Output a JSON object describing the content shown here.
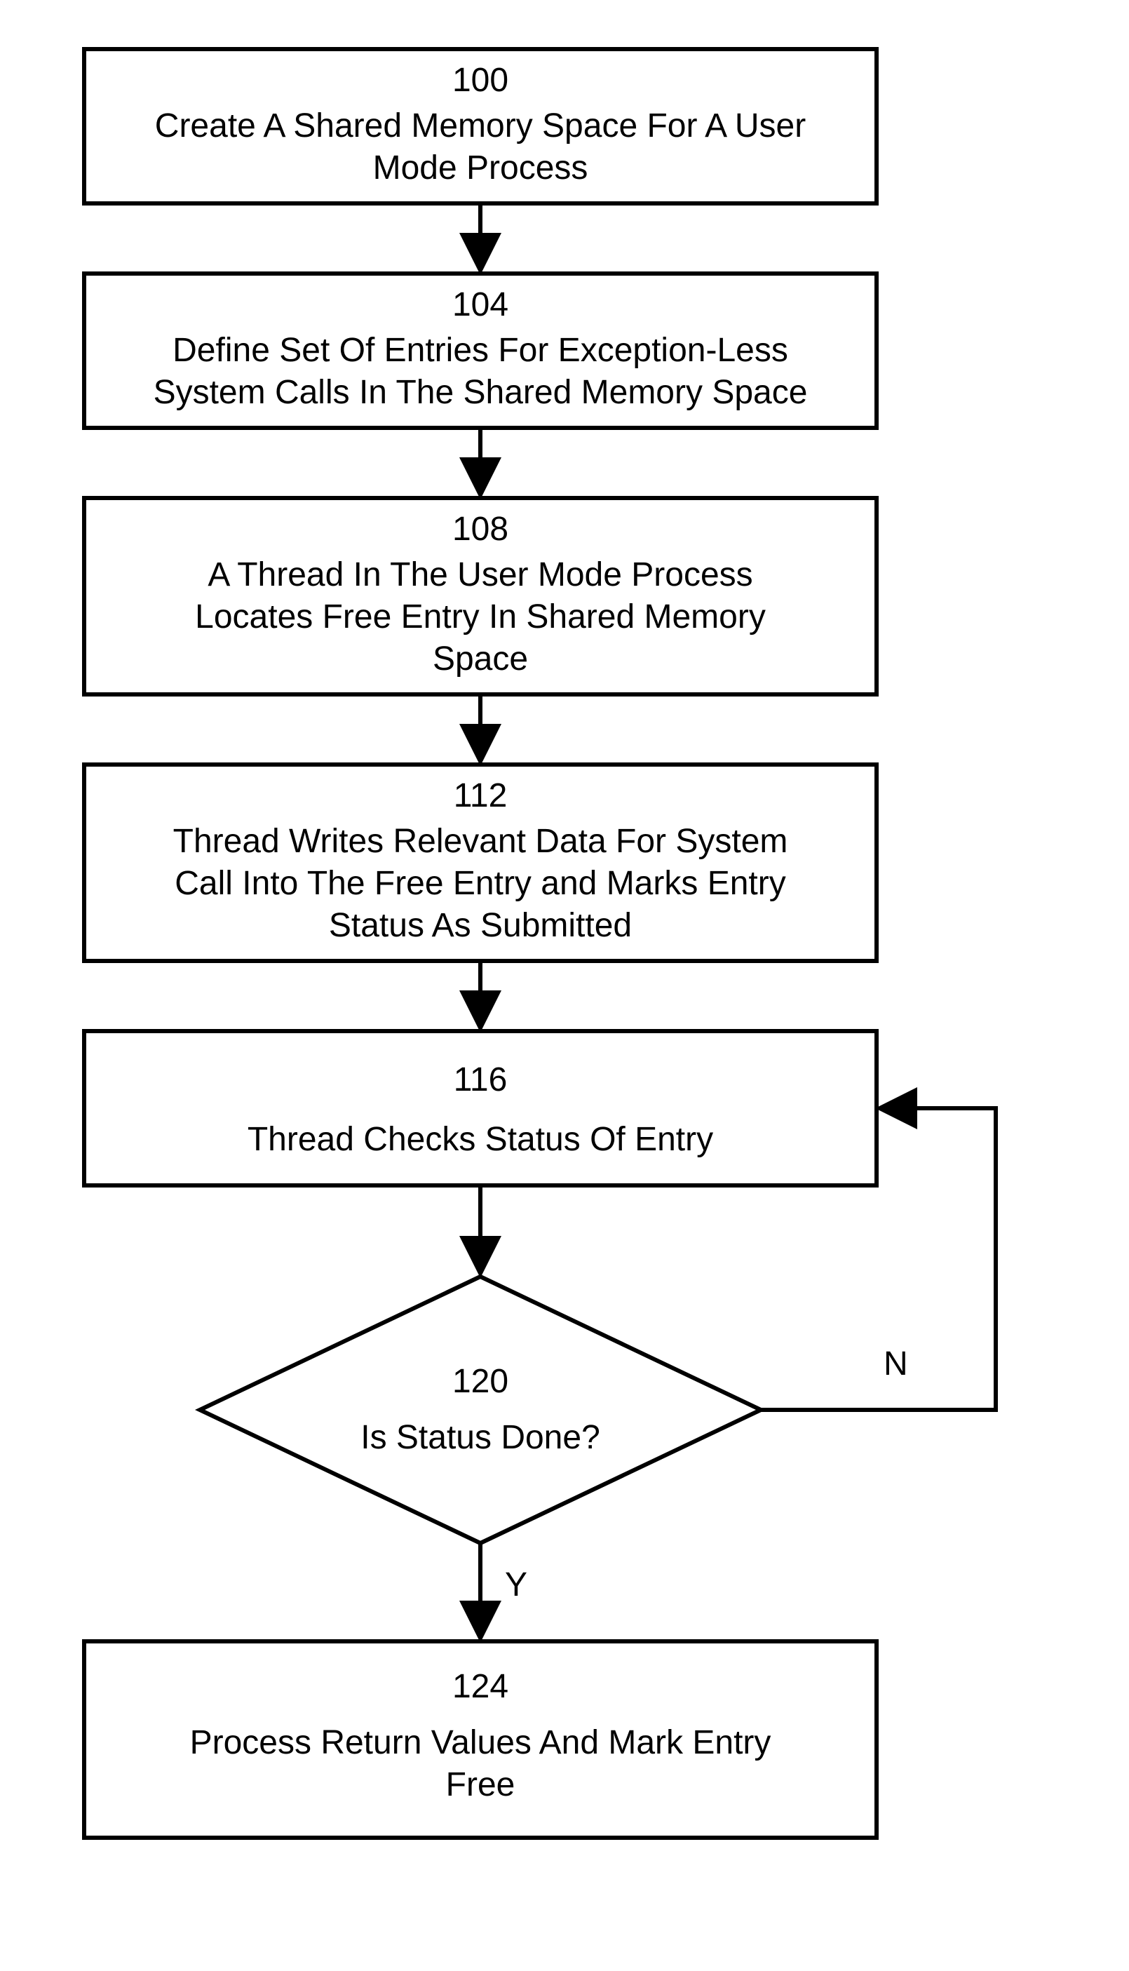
{
  "diagram": {
    "nodes": {
      "n100": {
        "id": "100",
        "line1": "Create A Shared Memory Space For A User",
        "line2": "Mode Process"
      },
      "n104": {
        "id": "104",
        "line1": "Define Set Of Entries For Exception-Less",
        "line2": "System Calls In The Shared Memory Space"
      },
      "n108": {
        "id": "108",
        "line1": "A Thread In The User Mode Process",
        "line2": "Locates Free Entry In Shared Memory",
        "line3": "Space"
      },
      "n112": {
        "id": "112",
        "line1": "Thread Writes Relevant Data For System",
        "line2": "Call Into The Free Entry and Marks Entry",
        "line3": "Status As Submitted"
      },
      "n116": {
        "id": "116",
        "line1": "Thread Checks Status Of Entry"
      },
      "n120": {
        "id": "120",
        "line1": "Is Status Done?"
      },
      "n124": {
        "id": "124",
        "line1": "Process Return Values And Mark Entry",
        "line2": "Free"
      }
    },
    "edges": {
      "no": "N",
      "yes": "Y"
    }
  },
  "chart_data": {
    "type": "flowchart",
    "nodes": [
      {
        "id": "100",
        "shape": "process",
        "text": "Create A Shared Memory Space For A User Mode Process"
      },
      {
        "id": "104",
        "shape": "process",
        "text": "Define Set Of Entries For Exception-Less System Calls In The Shared Memory Space"
      },
      {
        "id": "108",
        "shape": "process",
        "text": "A Thread In The User Mode Process Locates Free Entry In Shared Memory Space"
      },
      {
        "id": "112",
        "shape": "process",
        "text": "Thread Writes Relevant Data For System Call Into The Free Entry and Marks Entry Status As Submitted"
      },
      {
        "id": "116",
        "shape": "process",
        "text": "Thread Checks Status Of Entry"
      },
      {
        "id": "120",
        "shape": "decision",
        "text": "Is Status Done?"
      },
      {
        "id": "124",
        "shape": "process",
        "text": "Process Return Values And Mark Entry Free"
      }
    ],
    "edges": [
      {
        "from": "100",
        "to": "104",
        "label": ""
      },
      {
        "from": "104",
        "to": "108",
        "label": ""
      },
      {
        "from": "108",
        "to": "112",
        "label": ""
      },
      {
        "from": "112",
        "to": "116",
        "label": ""
      },
      {
        "from": "116",
        "to": "120",
        "label": ""
      },
      {
        "from": "120",
        "to": "124",
        "label": "Y"
      },
      {
        "from": "120",
        "to": "116",
        "label": "N"
      }
    ]
  }
}
